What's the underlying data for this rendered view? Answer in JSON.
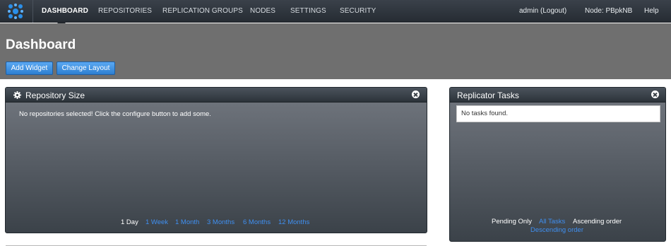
{
  "nav": {
    "items": [
      {
        "label": "DASHBOARD"
      },
      {
        "label": "REPOSITORIES"
      },
      {
        "label": "REPLICATION GROUPS"
      },
      {
        "label": "NODES"
      },
      {
        "label": "SETTINGS"
      },
      {
        "label": "SECURITY"
      }
    ],
    "active": "DASHBOARD",
    "user": "admin",
    "logout": "(Logout)",
    "node": "Node: PBpkNB",
    "help": "Help"
  },
  "header": {
    "title": "Dashboard",
    "add_widget": "Add Widget",
    "change_layout": "Change Layout"
  },
  "repo_widget": {
    "title": "Repository Size",
    "message": "No repositories selected! Click the configure button to add some.",
    "ranges": [
      "1 Day",
      "1 Week",
      "1 Month",
      "3 Months",
      "6 Months",
      "12 Months"
    ],
    "selected_range": "1 Day"
  },
  "tasks_widget": {
    "title": "Replicator Tasks",
    "empty": "No tasks found.",
    "pending_only": "Pending Only",
    "all_tasks": "All Tasks",
    "ascending": "Ascending order",
    "descending": "Descending order"
  },
  "colors": {
    "nav_bg": "#2f363e",
    "header_band": "#6f6f6f",
    "button": "#3d8fe0",
    "link": "#3f8ff0"
  },
  "icons": {
    "logo": "logo-icon",
    "gear": "gear-icon",
    "close": "close-icon"
  }
}
